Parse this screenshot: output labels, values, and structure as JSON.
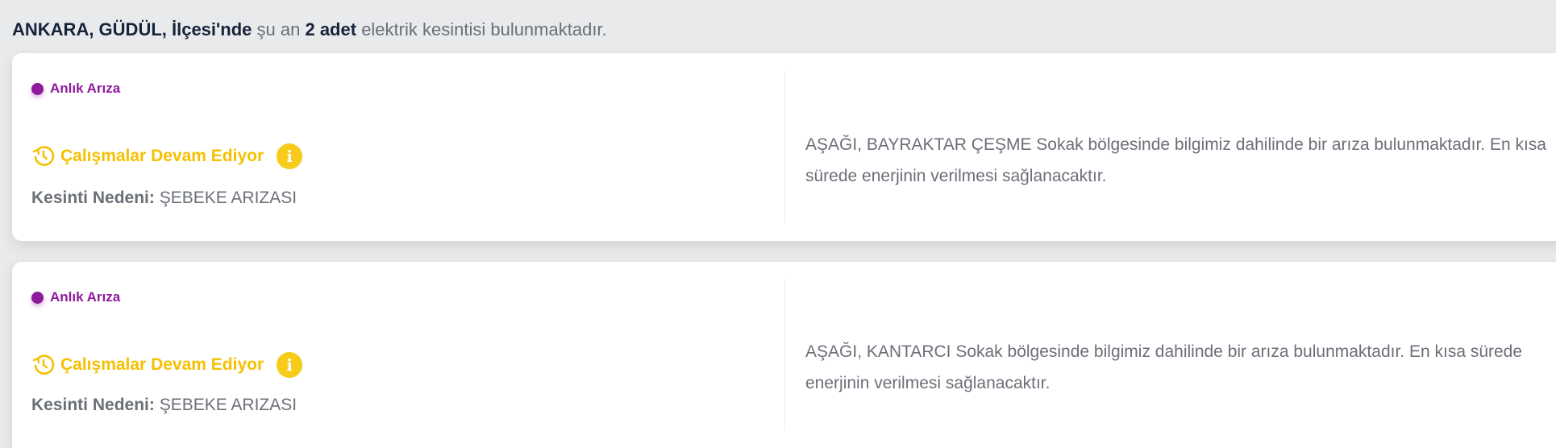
{
  "summary": {
    "location": "ANKARA, GÜDÜL, İlçesi'nde",
    "pre_count": "şu an",
    "count": "2 adet",
    "post_count": "elektrik kesintisi bulunmaktadır."
  },
  "colors": {
    "badge": "#8e1a9c",
    "status": "#f5c000",
    "text": "#6b6f78",
    "heading": "#17233a"
  },
  "outages": [
    {
      "type_label": "Anlık Arıza",
      "status_icon": "clock-rotate-icon",
      "status": "Çalışmalar Devam Ediyor",
      "info_icon": "info-icon",
      "info_symbol": "i",
      "reason_label": "Kesinti Nedeni:",
      "reason_value": "ŞEBEKE ARIZASI",
      "description": "AŞAĞI, BAYRAKTAR ÇEŞME Sokak bölgesinde bilgimiz dahilinde bir arıza bulunmaktadır. En kısa sürede enerjinin verilmesi sağlanacaktır."
    },
    {
      "type_label": "Anlık Arıza",
      "status_icon": "clock-rotate-icon",
      "status": "Çalışmalar Devam Ediyor",
      "info_icon": "info-icon",
      "info_symbol": "i",
      "reason_label": "Kesinti Nedeni:",
      "reason_value": "ŞEBEKE ARIZASI",
      "description": "AŞAĞI, KANTARCI Sokak bölgesinde bilgimiz dahilinde bir arıza bulunmaktadır. En kısa sürede enerjinin verilmesi sağlanacaktır."
    }
  ]
}
